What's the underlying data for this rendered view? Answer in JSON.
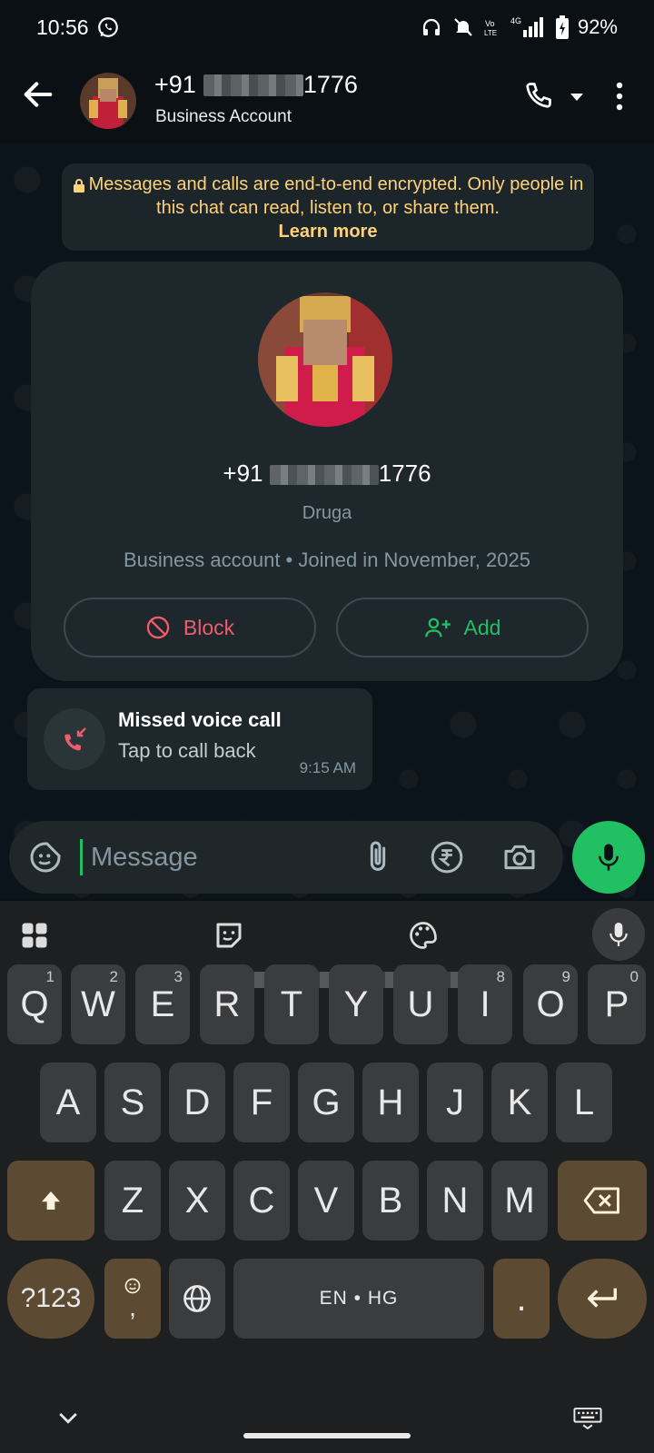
{
  "status_bar": {
    "time": "10:56",
    "battery": "92%"
  },
  "header": {
    "title_prefix": "+91",
    "title_suffix": "1776",
    "subtitle": "Business Account"
  },
  "encryption_notice": {
    "text": "Messages and calls are end-to-end encrypted. Only people in this chat can read, listen to, or share them.",
    "link": "Learn more"
  },
  "contact_card": {
    "number_prefix": "+91",
    "number_suffix": "1776",
    "name": "Druga",
    "meta": "Business account • Joined in November, 2025",
    "block_label": "Block",
    "add_label": "Add"
  },
  "missed_call": {
    "title": "Missed voice call",
    "subtitle": "Tap to call back",
    "time": "9:15 AM"
  },
  "compose": {
    "placeholder": "Message"
  },
  "keyboard": {
    "row1": [
      {
        "k": "Q",
        "h": "1"
      },
      {
        "k": "W",
        "h": "2"
      },
      {
        "k": "E",
        "h": "3"
      },
      {
        "k": "R",
        "h": ""
      },
      {
        "k": "T",
        "h": ""
      },
      {
        "k": "Y",
        "h": ""
      },
      {
        "k": "U",
        "h": ""
      },
      {
        "k": "I",
        "h": "8"
      },
      {
        "k": "O",
        "h": "9"
      },
      {
        "k": "P",
        "h": "0"
      }
    ],
    "row2": [
      "A",
      "S",
      "D",
      "F",
      "G",
      "H",
      "J",
      "K",
      "L"
    ],
    "row3": [
      "Z",
      "X",
      "C",
      "V",
      "B",
      "N",
      "M"
    ],
    "symbols_label": "?123",
    "emoji_comma": ",",
    "space_label": "EN • HG",
    "period_label": "."
  },
  "colors": {
    "accent_green": "#21c063",
    "block_red": "#f15c6d",
    "notice_yellow": "#ffd279",
    "fn_key": "#5c4a32"
  }
}
